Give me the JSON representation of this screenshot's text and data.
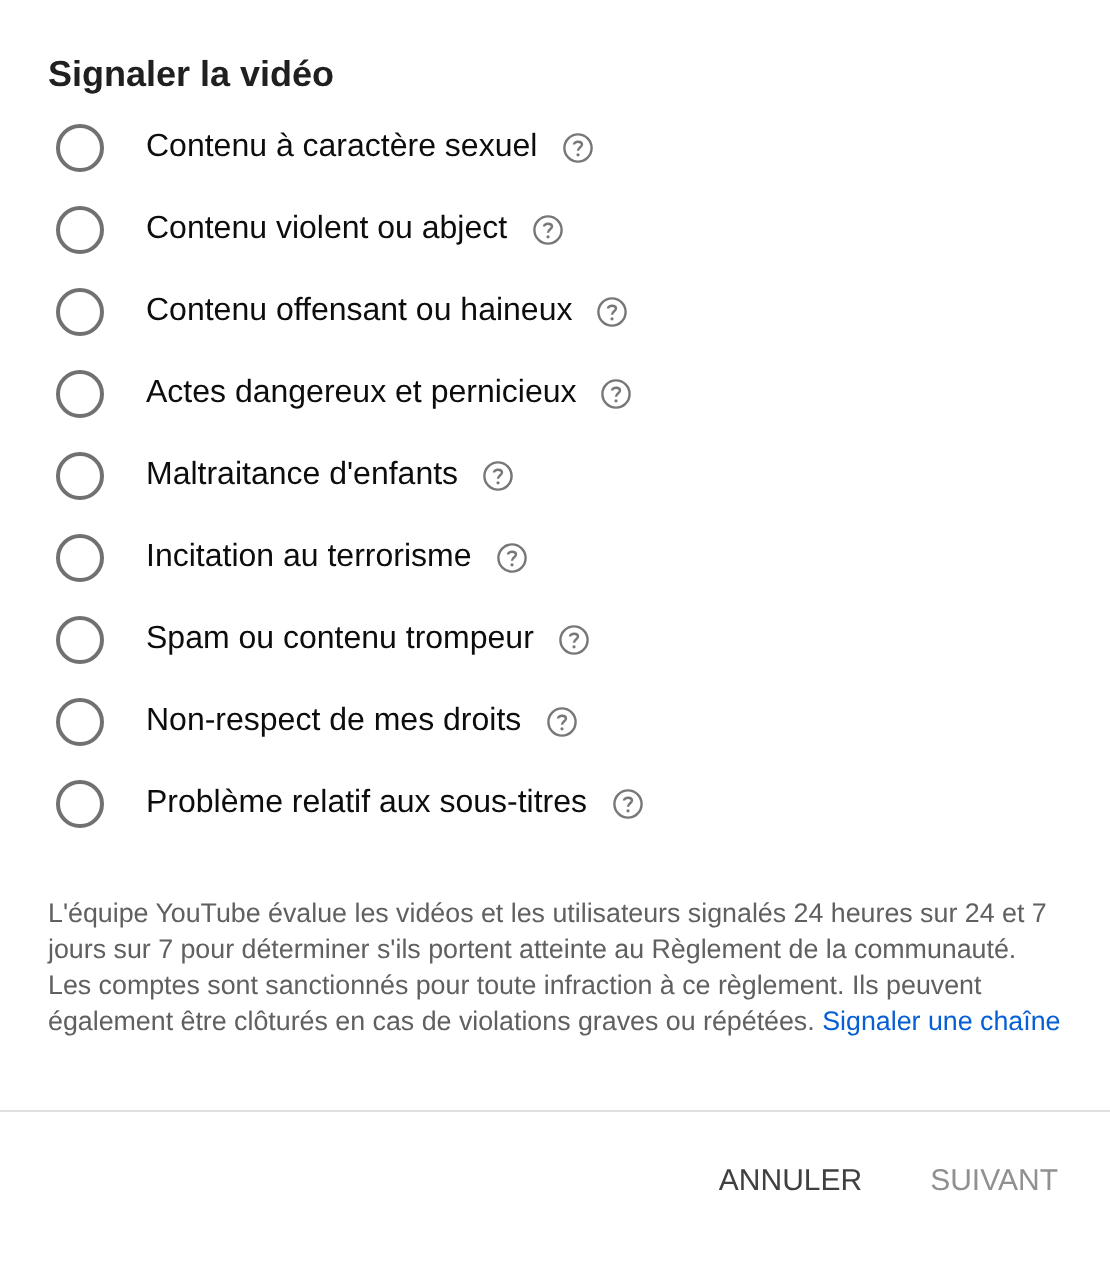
{
  "dialog": {
    "title": "Signaler la vidéo",
    "options": [
      {
        "label": "Contenu à caractère sexuel",
        "selected": false
      },
      {
        "label": "Contenu violent ou abject",
        "selected": false
      },
      {
        "label": "Contenu offensant ou haineux",
        "selected": false
      },
      {
        "label": "Actes dangereux et pernicieux",
        "selected": false
      },
      {
        "label": "Maltraitance d'enfants",
        "selected": false
      },
      {
        "label": "Incitation au terrorisme",
        "selected": false
      },
      {
        "label": "Spam ou contenu trompeur",
        "selected": false
      },
      {
        "label": "Non-respect de mes droits",
        "selected": false
      },
      {
        "label": "Problème relatif aux sous-titres",
        "selected": false
      }
    ],
    "notice": {
      "text": "L'équipe YouTube évalue les vidéos et les utilisateurs signalés 24 heures sur 24 et 7 jours sur 7 pour déterminer s'ils portent atteinte au Règlement de la communauté. Les comptes sont sanctionnés pour toute infraction à ce règlement. Ils peuvent également être clôturés en cas de violations graves ou répétées.",
      "link": "Signaler une chaîne"
    },
    "buttons": [
      {
        "label": "ANNULER",
        "disabled": false
      },
      {
        "label": "SUIVANT",
        "disabled": true
      }
    ]
  }
}
